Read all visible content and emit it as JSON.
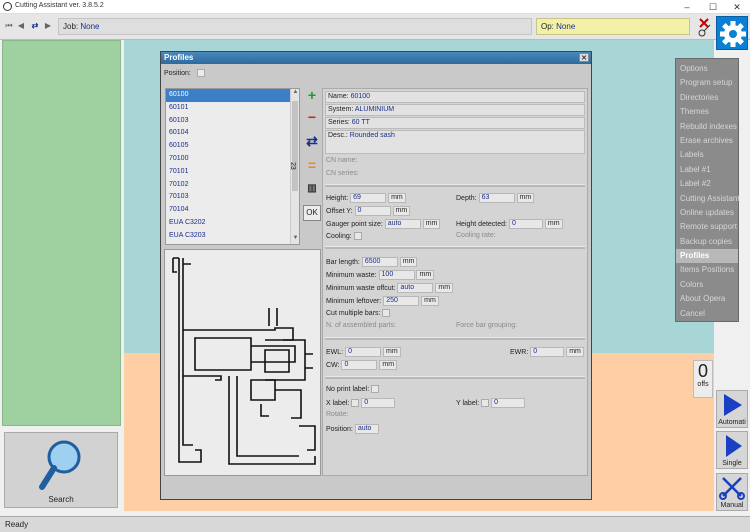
{
  "window": {
    "title": "Cutting Assistant ver. 3.8.5.2",
    "minimize": "–",
    "maximize": "☐",
    "close": "✕"
  },
  "toolbar": {
    "job_label": "Job:",
    "job_value": "None",
    "op_label": "Op:",
    "op_value": "None"
  },
  "search": {
    "label": "Search"
  },
  "menu": {
    "items": [
      "Options",
      "Program setup",
      "Directories",
      "Themes",
      "Rebuild indexes",
      "Erase archives",
      "Labels",
      "Label #1",
      "Label #2",
      "Cutting Assistant",
      "Online updates",
      "Remote support",
      "Backup copies",
      "Profiles",
      "Items Positions",
      "Colors",
      "About Opera",
      "Cancel"
    ],
    "active": "Profiles"
  },
  "offs": {
    "count": "0",
    "label": "offs"
  },
  "side_buttons": {
    "auto": "Automati",
    "single": "Single",
    "manual": "Manual"
  },
  "dialog": {
    "title": "Profiles",
    "position_label": "Position:",
    "profiles": [
      "60100",
      "60101",
      "60103",
      "60104",
      "60105",
      "70100",
      "70101",
      "70102",
      "70103",
      "70104",
      "EUA C3202",
      "EUA C3203"
    ],
    "selected": "60100",
    "count": "23",
    "ok_label": "OK",
    "name_label": "Name:",
    "name_value": "60100",
    "system_label": "System:",
    "system_value": "ALUMINIUM",
    "series_label": "Series:",
    "series_value": "60 TT",
    "desc_label": "Desc.:",
    "desc_value": "Rounded sash",
    "cn_name_label": "CN name:",
    "cn_series_label": "CN series:",
    "height_label": "Height:",
    "height_value": "69",
    "height_unit": "mm",
    "depth_label": "Depth:",
    "depth_value": "63",
    "depth_unit": "mm",
    "offset_y_label": "Offset Y:",
    "offset_y_value": "0",
    "offset_y_unit": "mm",
    "gauger_label": "Gauger point size:",
    "gauger_value": "auto",
    "gauger_unit": "mm",
    "height_detected_label": "Height detected:",
    "height_detected_value": "0",
    "height_detected_unit": "mm",
    "cooling_label": "Cooling:",
    "cooling_rate_label": "Cooling rate:",
    "bar_length_label": "Bar length:",
    "bar_length_value": "6500",
    "bar_length_unit": "mm",
    "min_waste_label": "Minimum waste:",
    "min_waste_value": "100",
    "min_waste_unit": "mm",
    "min_waste_offcut_label": "Minimum waste offcut:",
    "min_waste_offcut_value": "auto",
    "min_waste_offcut_unit": "mm",
    "min_leftover_label": "Minimum leftover:",
    "min_leftover_value": "250",
    "min_leftover_unit": "mm",
    "cut_multiple_label": "Cut multiple bars:",
    "assembled_label": "N. of assembled parts:",
    "force_bar_label": "Force bar grouping:",
    "ewl_label": "EWL:",
    "ewl_value": "0",
    "ewl_unit": "mm",
    "ewr_label": "EWR:",
    "ewr_value": "0",
    "ewr_unit": "mm",
    "cw_label": "CW:",
    "cw_value": "0",
    "cw_unit": "mm",
    "no_print_label": "No print label:",
    "x_label_label": "X label:",
    "x_label_value": "0",
    "y_label_label": "Y label:",
    "y_label_value": "0",
    "rotate_label": "Rotate:",
    "position_field_label": "Position:",
    "position_field_value": "auto"
  },
  "status": {
    "text": "Ready"
  },
  "colors": {
    "accent": "#0a7fd6",
    "cyan_area": "#a8d6d6",
    "peach_area": "#fecfa4",
    "green_panel": "#9fd09f",
    "menu_bg": "#8b8b8b"
  }
}
